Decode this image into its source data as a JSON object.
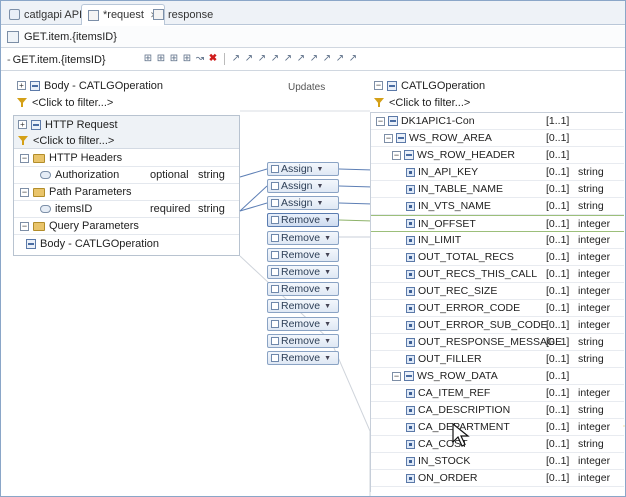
{
  "tabs": [
    {
      "label": "catlgapi API"
    },
    {
      "label": "*request"
    },
    {
      "label": "response"
    }
  ],
  "title": "GET.item.{itemsID}",
  "subheader": "GET.item.{itemsID}",
  "updates_label": "Updates",
  "left": {
    "body_header": "Body - CATLGOperation",
    "filter": "<Click to filter...>",
    "http_request": "HTTP Request",
    "http_filter": "<Click to filter...>",
    "http_headers": "HTTP Headers",
    "authorization": {
      "name": "Authorization",
      "req": "optional",
      "type": "string"
    },
    "path_params": "Path Parameters",
    "itemsid": {
      "name": "itemsID",
      "req": "required",
      "type": "string"
    },
    "query_params": "Query Parameters",
    "body_op": "Body - CATLGOperation"
  },
  "transforms": [
    {
      "label": "Assign"
    },
    {
      "label": "Assign"
    },
    {
      "label": "Assign"
    },
    {
      "label": "Remove"
    },
    {
      "label": "Remove"
    },
    {
      "label": "Remove"
    },
    {
      "label": "Remove"
    },
    {
      "label": "Remove"
    },
    {
      "label": "Remove"
    },
    {
      "label": "Remove"
    },
    {
      "label": "Remove"
    },
    {
      "label": "Remove"
    }
  ],
  "right": {
    "header": "CATLGOperation",
    "filter": "<Click to filter...>",
    "rows": [
      {
        "name": "DK1APIC1-Con",
        "card": "[1..1]",
        "type": ""
      },
      {
        "name": "WS_ROW_AREA",
        "card": "[0..1]",
        "type": ""
      },
      {
        "name": "WS_ROW_HEADER",
        "card": "[0..1]",
        "type": ""
      },
      {
        "name": "IN_API_KEY",
        "card": "[0..1]",
        "type": "string"
      },
      {
        "name": "IN_TABLE_NAME",
        "card": "[0..1]",
        "type": "string"
      },
      {
        "name": "IN_VTS_NAME",
        "card": "[0..1]",
        "type": "string"
      },
      {
        "name": "IN_OFFSET",
        "card": "[0..1]",
        "type": "integer"
      },
      {
        "name": "IN_LIMIT",
        "card": "[0..1]",
        "type": "integer"
      },
      {
        "name": "OUT_TOTAL_RECS",
        "card": "[0..1]",
        "type": "integer"
      },
      {
        "name": "OUT_RECS_THIS_CALL",
        "card": "[0..1]",
        "type": "integer"
      },
      {
        "name": "OUT_REC_SIZE",
        "card": "[0..1]",
        "type": "integer"
      },
      {
        "name": "OUT_ERROR_CODE",
        "card": "[0..1]",
        "type": "integer"
      },
      {
        "name": "OUT_ERROR_SUB_CODE",
        "card": "[0..1]",
        "type": "integer"
      },
      {
        "name": "OUT_RESPONSE_MESSAGE",
        "card": "[0..1]",
        "type": "string"
      },
      {
        "name": "OUT_FILLER",
        "card": "[0..1]",
        "type": "string"
      },
      {
        "name": "WS_ROW_DATA",
        "card": "[0..1]",
        "type": ""
      },
      {
        "name": "CA_ITEM_REF",
        "card": "[0..1]",
        "type": "integer"
      },
      {
        "name": "CA_DESCRIPTION",
        "card": "[0..1]",
        "type": "string"
      },
      {
        "name": "CA_DEPARTMENT",
        "card": "[0..1]",
        "type": "integer"
      },
      {
        "name": "CA_COST",
        "card": "[0..1]",
        "type": "string"
      },
      {
        "name": "IN_STOCK",
        "card": "[0..1]",
        "type": "integer"
      },
      {
        "name": "ON_ORDER",
        "card": "[0..1]",
        "type": "integer"
      }
    ]
  }
}
